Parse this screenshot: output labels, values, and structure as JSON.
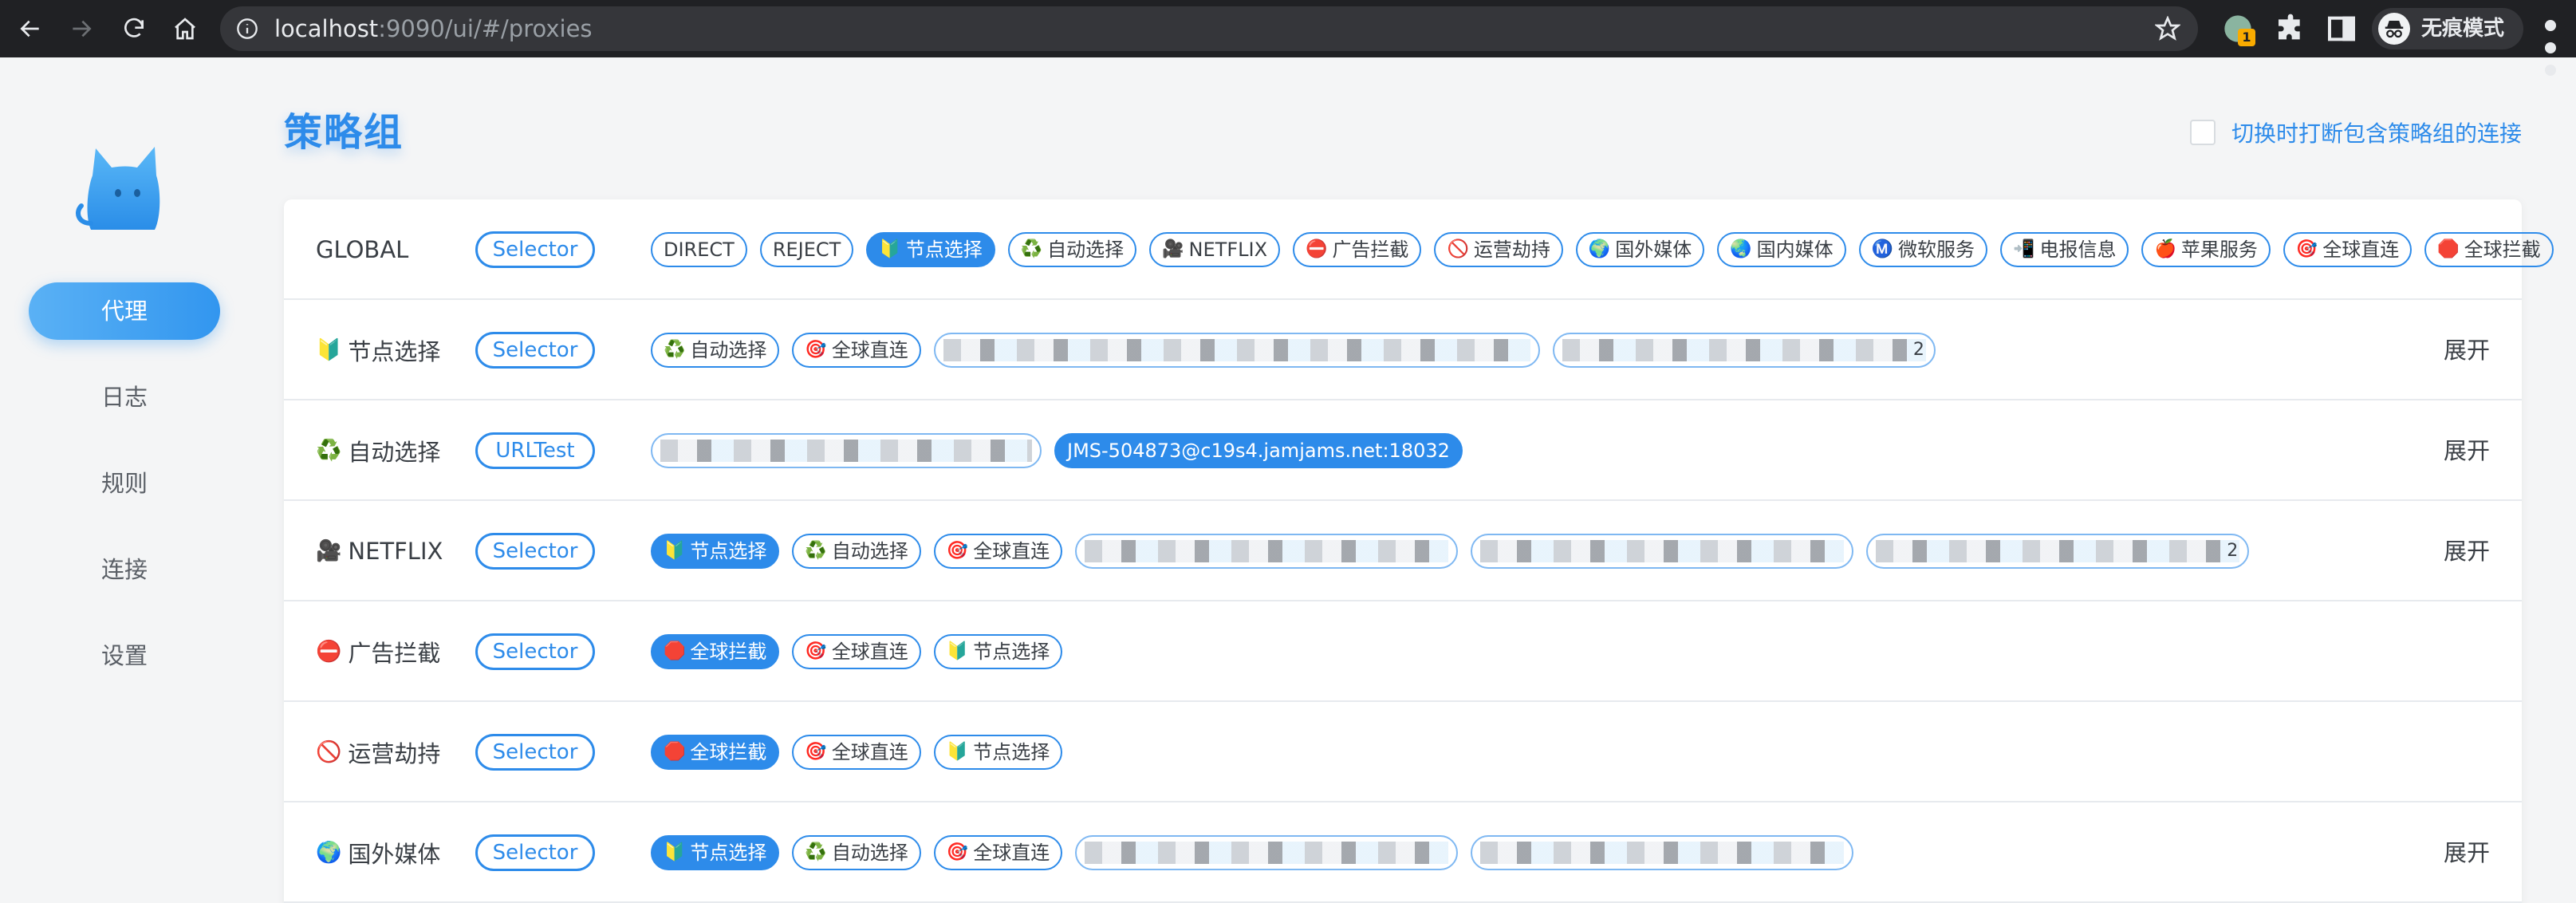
{
  "browser": {
    "url_host": "localhost",
    "url_rest": ":9090/ui/#/proxies",
    "extension_badge": "1",
    "profile_label": "无痕模式"
  },
  "sidebar": {
    "items": [
      {
        "label": "代理",
        "active": true
      },
      {
        "label": "日志",
        "active": false
      },
      {
        "label": "规则",
        "active": false
      },
      {
        "label": "连接",
        "active": false
      },
      {
        "label": "设置",
        "active": false
      }
    ]
  },
  "header": {
    "title": "策略组",
    "toggle_label": "切换时打断包含策略组的连接"
  },
  "groups": [
    {
      "name": "GLOBAL",
      "emoji": "",
      "type": "Selector",
      "expand": "",
      "tags": [
        {
          "icon": "",
          "label": "DIRECT"
        },
        {
          "icon": "",
          "label": "REJECT"
        },
        {
          "icon": "🔰",
          "label": "节点选择",
          "selected": true
        },
        {
          "icon": "♻️",
          "label": "自动选择"
        },
        {
          "icon": "🎥",
          "label": "NETFLIX"
        },
        {
          "icon": "⛔",
          "label": "广告拦截"
        },
        {
          "icon": "🚫",
          "label": "运营劫持"
        },
        {
          "icon": "🌍",
          "label": "国外媒体"
        },
        {
          "icon": "🌏",
          "label": "国内媒体"
        },
        {
          "icon": "Ⓜ️",
          "label": "微软服务"
        },
        {
          "icon": "📲",
          "label": "电报信息"
        },
        {
          "icon": "🍎",
          "label": "苹果服务"
        },
        {
          "icon": "🎯",
          "label": "全球直连"
        },
        {
          "icon": "🛑",
          "label": "全球拦截"
        }
      ]
    },
    {
      "name": "节点选择",
      "emoji": "🔰",
      "type": "Selector",
      "expand": "展开",
      "tags": [
        {
          "icon": "♻️",
          "label": "自动选择"
        },
        {
          "icon": "🎯",
          "label": "全球直连"
        },
        {
          "blurred": true,
          "label": ""
        },
        {
          "blurred": true,
          "label": "",
          "more": "2"
        }
      ]
    },
    {
      "name": "自动选择",
      "emoji": "♻️",
      "type": "URLTest",
      "expand": "展开",
      "tags": [
        {
          "blurred": true,
          "label": ""
        },
        {
          "icon": "",
          "label": "JMS-504873@c19s4.jamjams.net:18032",
          "selected": true
        }
      ]
    },
    {
      "name": "NETFLIX",
      "emoji": "🎥",
      "type": "Selector",
      "expand": "展开",
      "tags": [
        {
          "icon": "🔰",
          "label": "节点选择",
          "selected": true
        },
        {
          "icon": "♻️",
          "label": "自动选择"
        },
        {
          "icon": "🎯",
          "label": "全球直连"
        },
        {
          "blurred": true,
          "label": ""
        },
        {
          "blurred": true,
          "label": ""
        },
        {
          "blurred": true,
          "label": "",
          "more": "2"
        }
      ]
    },
    {
      "name": "广告拦截",
      "emoji": "⛔",
      "type": "Selector",
      "expand": "",
      "tags": [
        {
          "icon": "🛑",
          "label": "全球拦截",
          "selected": true
        },
        {
          "icon": "🎯",
          "label": "全球直连"
        },
        {
          "icon": "🔰",
          "label": "节点选择"
        }
      ]
    },
    {
      "name": "运营劫持",
      "emoji": "🚫",
      "type": "Selector",
      "expand": "",
      "tags": [
        {
          "icon": "🛑",
          "label": "全球拦截",
          "selected": true
        },
        {
          "icon": "🎯",
          "label": "全球直连"
        },
        {
          "icon": "🔰",
          "label": "节点选择"
        }
      ]
    },
    {
      "name": "国外媒体",
      "emoji": "🌍",
      "type": "Selector",
      "expand": "展开",
      "tags": [
        {
          "icon": "🔰",
          "label": "节点选择",
          "selected": true
        },
        {
          "icon": "♻️",
          "label": "自动选择"
        },
        {
          "icon": "🎯",
          "label": "全球直连"
        },
        {
          "blurred": true,
          "label": ""
        },
        {
          "blurred": true,
          "label": ""
        }
      ]
    }
  ]
}
